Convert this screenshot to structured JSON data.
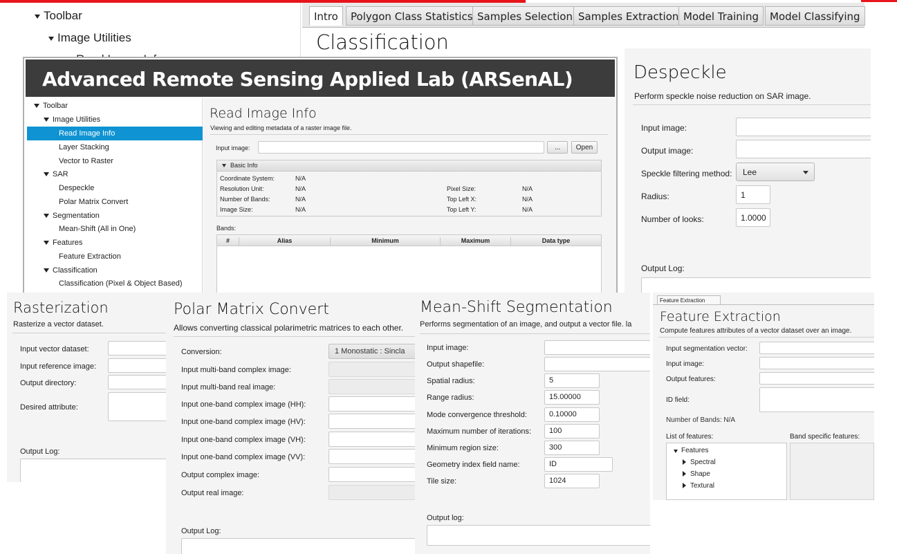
{
  "top_window": {
    "tree": [
      "Toolbar",
      "Image Utilities",
      "Read Image Info"
    ],
    "tabs": [
      "Intro",
      "Polygon Class Statistics",
      "Samples Selection",
      "Samples Extraction",
      "Model Training",
      "Model Classifying"
    ],
    "heading": "Classification"
  },
  "main": {
    "banner": "Advanced Remote Sensing Applied Lab (ARSenAL)",
    "tree": {
      "toolbar": "Toolbar",
      "image_utilities": "Image Utilities",
      "read_image_info": "Read Image Info",
      "layer_stacking": "Layer Stacking",
      "vector_to_raster": "Vector to Raster",
      "sar": "SAR",
      "despeckle": "Despeckle",
      "polar_matrix_convert": "Polar Matrix Convert",
      "segmentation": "Segmentation",
      "mean_shift": "Mean-Shift (All in One)",
      "features": "Features",
      "feature_extraction": "Feature Extraction",
      "classification": "Classification",
      "classification_pixel_object": "Classification (Pixel & Object Based)"
    },
    "title": "Read Image Info",
    "subtitle": "Viewing and editing metadata of a raster image file.",
    "input_image_label": "Input image:",
    "browse_label": "...",
    "open_label": "Open",
    "basic_info_label": "Basic Info",
    "info": {
      "coordinate_system_label": "Coordinate System:",
      "coordinate_system_value": "N/A",
      "resolution_unit_label": "Resolution Unit:",
      "resolution_unit_value": "N/A",
      "number_of_bands_label": "Number of Bands:",
      "number_of_bands_value": "N/A",
      "image_size_label": "Image Size:",
      "image_size_value": "N/A",
      "pixel_size_label": "Pixel Size:",
      "pixel_size_value": "N/A",
      "top_left_x_label": "Top Left X:",
      "top_left_x_value": "N/A",
      "top_left_y_label": "Top Left Y:",
      "top_left_y_value": "N/A"
    },
    "bands_label": "Bands:",
    "bands_columns": [
      "#",
      "Alias",
      "Minimum",
      "Maximum",
      "Data type"
    ]
  },
  "despeckle": {
    "title": "Despeckle",
    "subtitle": "Perform speckle noise reduction on SAR image.",
    "input_image_label": "Input image:",
    "output_image_label": "Output image:",
    "method_label": "Speckle filtering method:",
    "method_value": "Lee",
    "radius_label": "Radius:",
    "radius_value": "1",
    "looks_label": "Number of looks:",
    "looks_value": "1.0000",
    "output_log_label": "Output Log:"
  },
  "rasterization": {
    "title": "Rasterization",
    "subtitle": "Rasterize a vector dataset.",
    "input_vector_label": "Input vector dataset:",
    "input_reference_label": "Input reference image:",
    "output_directory_label": "Output directory:",
    "desired_attribute_label": "Desired attribute:",
    "output_log_label": "Output Log:"
  },
  "polar": {
    "title": "Polar Matrix Convert",
    "subtitle": "Allows converting classical polarimetric matrices to each other.",
    "conversion_label": "Conversion:",
    "conversion_value": "1 Monostatic : Sincla",
    "fields": [
      "Input multi-band complex image:",
      "Input multi-band real image:",
      "Input one-band complex image (HH):",
      "Input one-band complex image (HV):",
      "Input one-band complex image (VH):",
      "Input one-band complex image (VV):",
      "Output complex image:",
      "Output real image:"
    ],
    "output_log_label": "Output Log:"
  },
  "meanshift": {
    "title": "Mean-Shift Segmentation",
    "subtitle": "Performs segmentation of an image, and output a vector file. la",
    "input_image_label": "Input image:",
    "output_shapefile_label": "Output shapefile:",
    "spatial_radius_label": "Spatial radius:",
    "spatial_radius_value": "5",
    "range_radius_label": "Range radius:",
    "range_radius_value": "15.00000",
    "mode_label": "Mode convergence threshold:",
    "mode_value": "0.10000",
    "max_iter_label": "Maximum number of iterations:",
    "max_iter_value": "100",
    "min_region_label": "Minimum region size:",
    "min_region_value": "300",
    "geometry_label": "Geometry index field name:",
    "geometry_value": "ID",
    "tile_label": "Tile size:",
    "tile_value": "1024",
    "output_log_label": "Output log:"
  },
  "feature": {
    "tab_label": "Feature Extraction",
    "title": "Feature Extraction",
    "subtitle": "Compute features attributes of a vector dataset over an image.",
    "input_seg_label": "Input segmentation vector:",
    "input_image_label": "Input image:",
    "output_features_label": "Output features:",
    "id_field_label": "ID field:",
    "number_of_bands": "Number of Bands: N/A",
    "list_label": "List of features:",
    "band_specific_label": "Band specific features:",
    "tree": [
      "Features",
      "Spectral",
      "Shape",
      "Textural"
    ]
  },
  "colors": {
    "accent_red": "#e8141c",
    "banner_bg": "#3c3c3c",
    "selection": "#0f93d2"
  }
}
